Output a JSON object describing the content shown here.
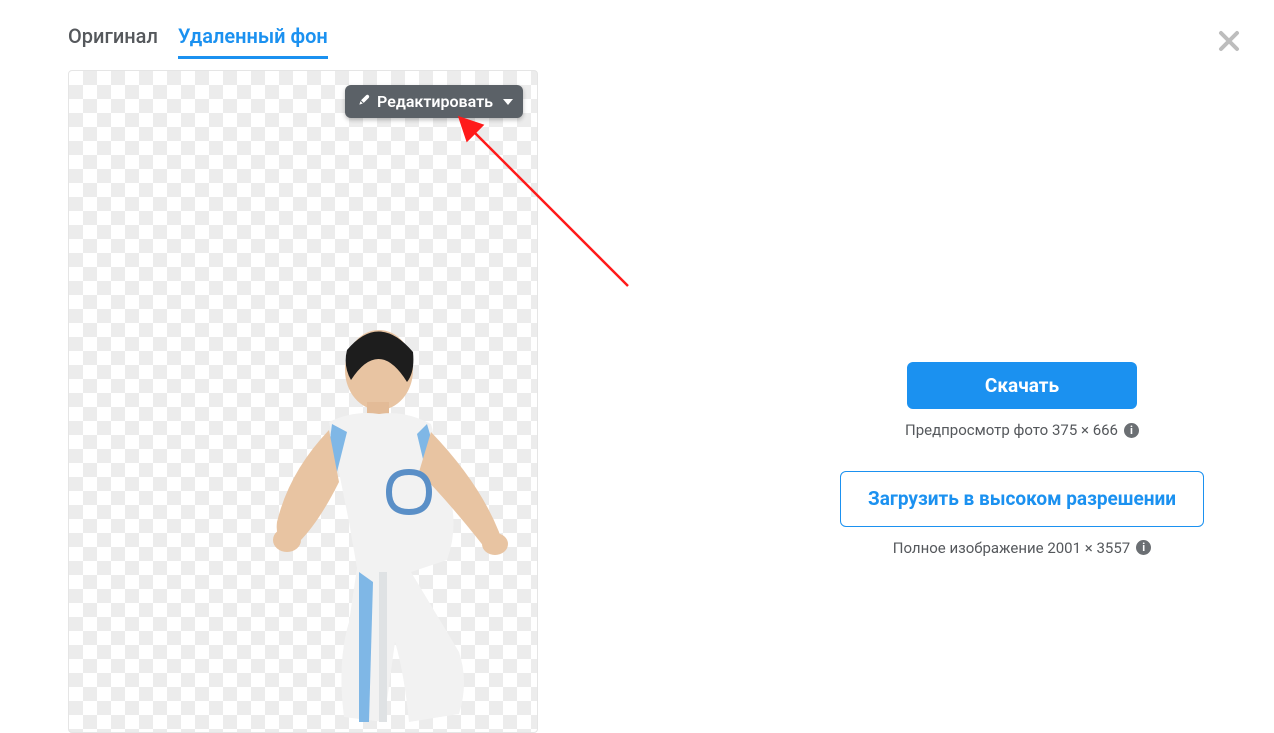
{
  "tabs": {
    "original": "Оригинал",
    "removed_bg": "Удаленный фон"
  },
  "edit_button": {
    "label": "Редактировать"
  },
  "actions": {
    "download_label": "Скачать",
    "preview_caption": "Предпросмотр фото 375 × 666",
    "high_res_label": "Загрузить в высоком разрешении",
    "full_caption": "Полное изображение 2001 × 3557"
  }
}
